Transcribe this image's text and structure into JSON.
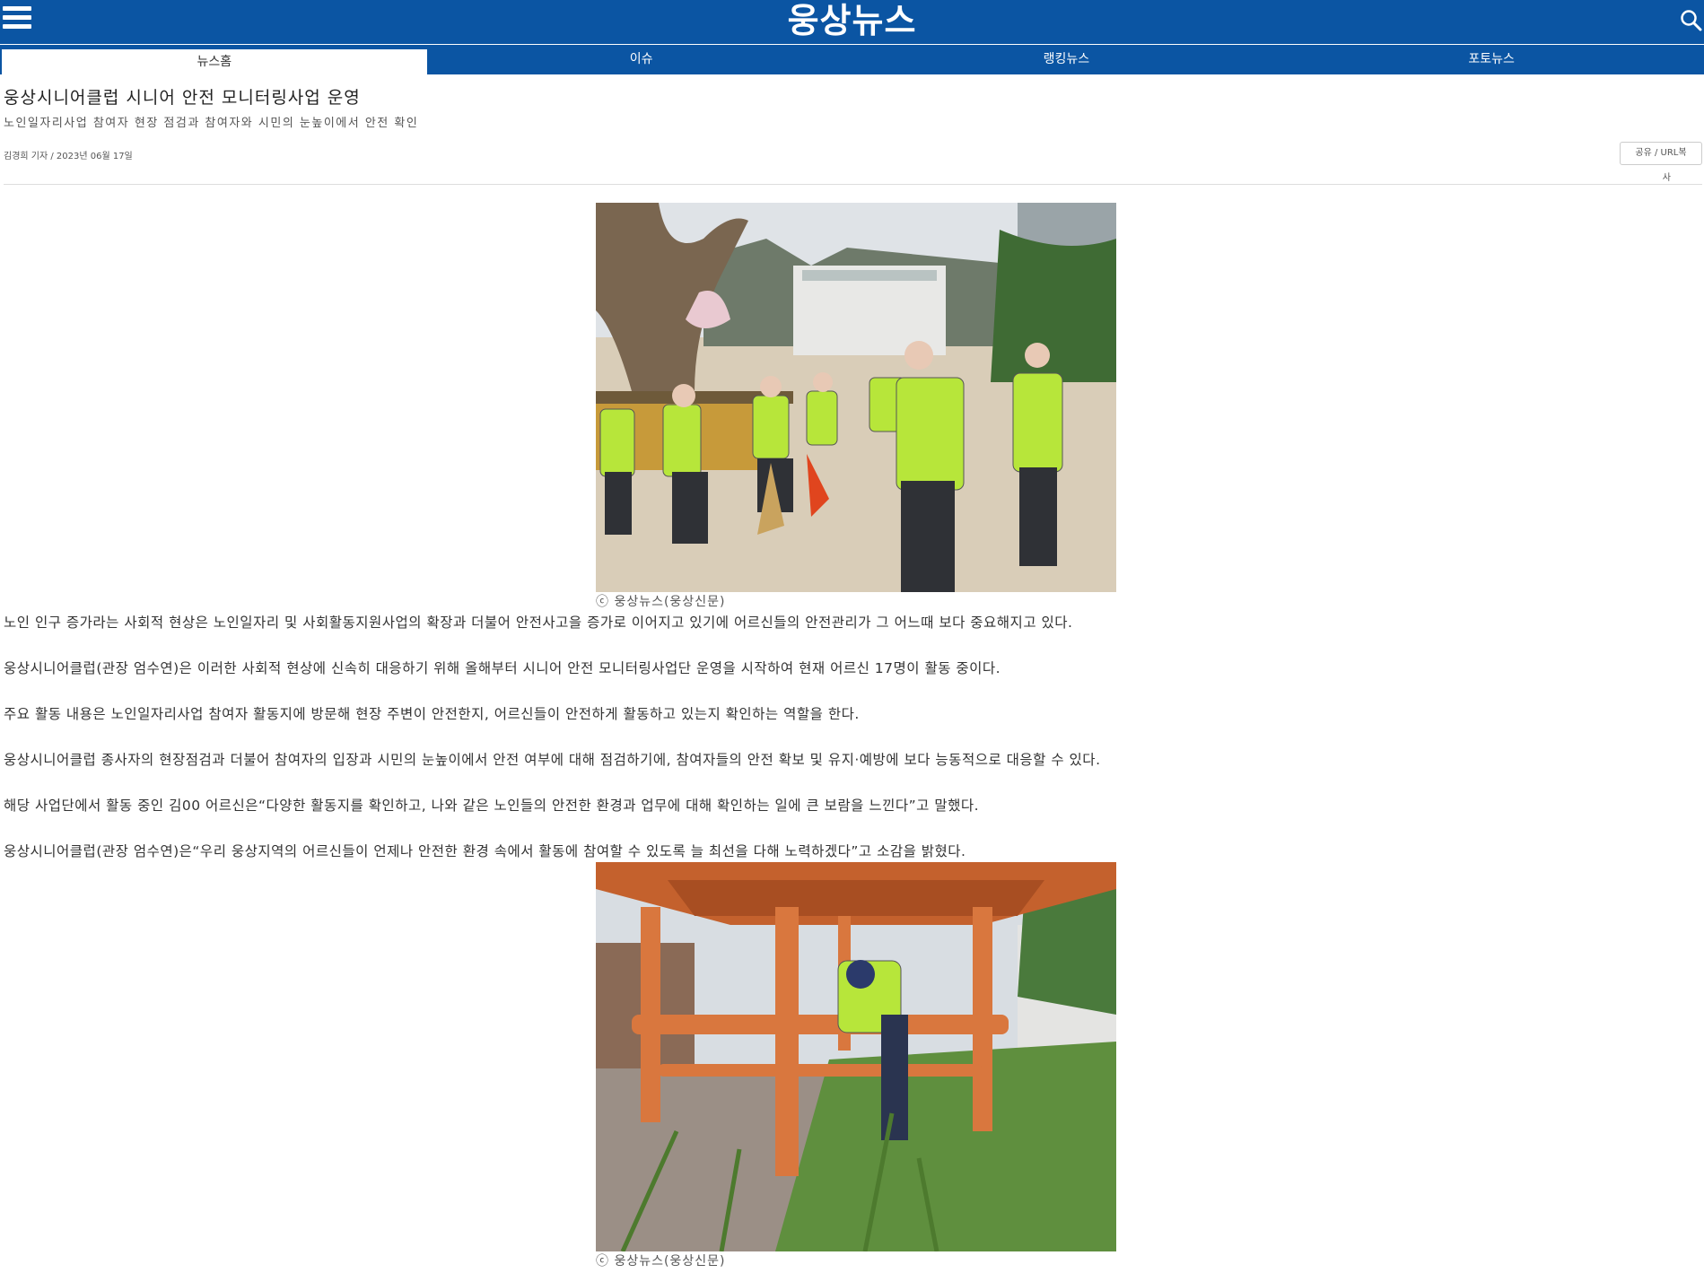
{
  "header": {
    "logo": "웅상뉴스",
    "menu_icon": "hamburger-menu-icon",
    "search_icon": "search-icon",
    "brand_color": "#0b55a3"
  },
  "nav": {
    "tabs": [
      {
        "label": "뉴스홈",
        "active": true
      },
      {
        "label": "이슈",
        "active": false
      },
      {
        "label": "랭킹뉴스",
        "active": false
      },
      {
        "label": "포토뉴스",
        "active": false
      }
    ]
  },
  "article": {
    "title": "웅상시니어클럽 시니어 안전 모니터링사업 운영",
    "subtitle": "노인일자리사업 참여자 현장 점검과 참여자와 시민의 눈높이에서 안전 확인",
    "byline": "김경희 기자 / 2023년 06월 17일",
    "share_label": "공유 / URL복",
    "share_label_tail": "사",
    "photo_caption_1": "ⓒ 웅상뉴스(웅상신문)",
    "photo_caption_2": "ⓒ 웅상뉴스(웅상신문)",
    "paragraphs": [
      "노인 인구 증가라는 사회적 현상은 노인일자리 및 사회활동지원사업의 확장과 더불어 안전사고을 증가로 이어지고 있기에 어르신들의 안전관리가 그 어느때 보다 중요해지고 있다.",
      "웅상시니어클럽(관장 엄수연)은 이러한 사회적 현상에 신속히 대응하기 위해 올해부터 시니어 안전 모니터링사업단 운영을 시작하여 현재 어르신 17명이 활동 중이다.",
      "주요 활동 내용은 노인일자리사업 참여자 활동지에 방문해 현장 주변이 안전한지, 어르신들이 안전하게 활동하고 있는지 확인하는 역할을 한다.",
      "웅상시니어클럽 종사자의 현장점검과 더불어 참여자의 입장과 시민의 눈높이에서 안전 여부에 대해 점검하기에, 참여자들의 안전 확보 및 유지·예방에 보다 능동적으로 대응할 수 있다.",
      "해당 사업단에서 활동 중인 김00 어르신은“다양한 활동지를 확인하고, 나와 같은 노인들의 안전한 환경과 업무에 대해 확인하는 일에 큰 보람을 느낀다”고 말했다.",
      "웅상시니어클럽(관장 엄수연)은“우리 웅상지역의 어르신들이 언제나 안전한 환경 속에서 활동에 참여할 수 있도록 늘 최선을 다해 노력하겠다”고 소감을 밝혔다."
    ]
  }
}
